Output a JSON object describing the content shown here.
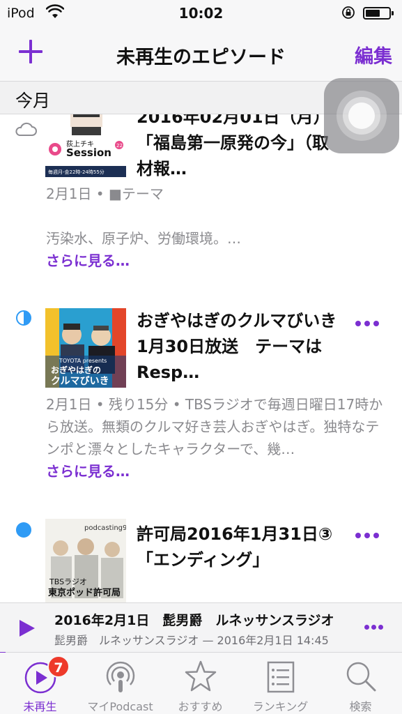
{
  "status_bar": {
    "carrier": "iPod",
    "time": "10:02"
  },
  "nav": {
    "title": "未再生のエピソード",
    "edit_label": "編集"
  },
  "section": {
    "title": "今月"
  },
  "episodes": [
    {
      "status": "cloud",
      "art_text": "荻上チキ Session 22",
      "title": "2016年02月01日（月）「福島第一原発の今」（取材報…",
      "meta": "2月1日 • ■テーマ",
      "description": "汚染水、原子炉、労働環境。…",
      "see_more": "さらに見る…"
    },
    {
      "status": "half-played",
      "art_text": "TOYOTA presents おぎやはぎのクルマびいき",
      "title": "おぎやはぎのクルマびいき　1月30日放送　テーマはResp…",
      "description": "2月1日 • 残り15分 • TBSラジオで毎週日曜日17時から放送。無類のクルマ好き芸人おぎやはぎ。独特なテンポと漂々としたキャラクターで、幾…",
      "see_more": "さらに見る…"
    },
    {
      "status": "unplayed",
      "art_text_top": "podcasting954",
      "art_text_bottom": "TBSラジオ 東京ポッド許可局",
      "title": "許可局2016年1月31日③「エンディング」"
    }
  ],
  "mini_player": {
    "title": "2016年2月1日　髭男爵　ルネッサンスラジオ",
    "subtitle": "髭男爵　ルネッサンスラジオ — 2016年2月1日 14:45"
  },
  "tabs": [
    {
      "label": "未再生",
      "icon": "play-circle-icon",
      "badge": "7",
      "active": true
    },
    {
      "label": "マイPodcast",
      "icon": "podcast-icon"
    },
    {
      "label": "おすすめ",
      "icon": "star-icon"
    },
    {
      "label": "ランキング",
      "icon": "list-icon"
    },
    {
      "label": "検索",
      "icon": "search-icon"
    }
  ],
  "colors": {
    "accent": "#7b2fd1",
    "unplayed_dot": "#2f9bf5",
    "badge": "#ee3a2b"
  }
}
